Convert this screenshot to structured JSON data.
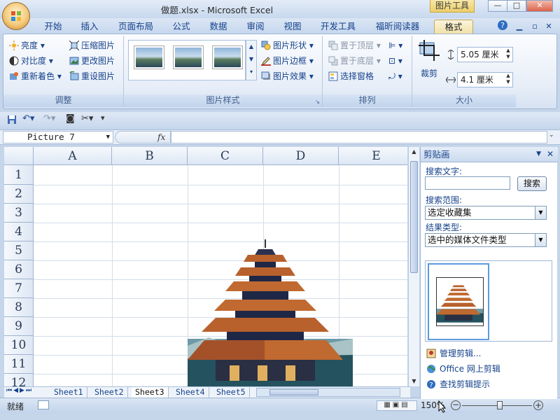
{
  "window": {
    "title": "做题.xlsx - Microsoft Excel",
    "context_tab": "图片工具",
    "min": "—",
    "restore": "□",
    "close": "✕"
  },
  "tabs": [
    "开始",
    "插入",
    "页面布局",
    "公式",
    "数据",
    "审阅",
    "视图",
    "开发工具",
    "福昕阅读器",
    "格式"
  ],
  "active_tab": "格式",
  "ribbon": {
    "adjust": {
      "label": "调整",
      "items": [
        "亮度",
        "对比度",
        "重新着色",
        "压缩图片",
        "更改图片",
        "重设图片"
      ]
    },
    "styles": {
      "label": "图片样式",
      "items": [
        "图片形状",
        "图片边框",
        "图片效果"
      ]
    },
    "arrange": {
      "label": "排列",
      "items": [
        "置于顶层",
        "置于底层",
        "选择窗格"
      ]
    },
    "size": {
      "label": "大小",
      "crop": "裁剪",
      "height": "5.05 厘米",
      "width": "4.1 厘米"
    }
  },
  "formula": {
    "name_box": "Picture 7",
    "fx": "fx",
    "value": ""
  },
  "grid": {
    "columns": [
      "A",
      "B",
      "C",
      "D",
      "E"
    ],
    "rows": [
      "1",
      "2",
      "3",
      "4",
      "5",
      "6",
      "7",
      "8",
      "9",
      "10",
      "11",
      "12"
    ]
  },
  "sheets": [
    "Sheet1",
    "Sheet2",
    "Sheet3",
    "Sheet4",
    "Sheet5"
  ],
  "active_sheet": "Sheet3",
  "status": {
    "ready": "就绪",
    "zoom": "150%"
  },
  "taskpane": {
    "title": "剪贴画",
    "search_label": "搜索文字:",
    "search_value": "",
    "search_button": "搜索",
    "scope_label": "搜索范围:",
    "scope_value": "选定收藏集",
    "type_label": "结果类型:",
    "type_value": "选中的媒体文件类型",
    "links": [
      "管理剪辑...",
      "Office 网上剪辑",
      "查找剪辑提示"
    ]
  },
  "colors": {
    "ribbon_bg": "#dfe8f5",
    "accent": "#15428b",
    "active_tab": "#f1e2a8"
  }
}
